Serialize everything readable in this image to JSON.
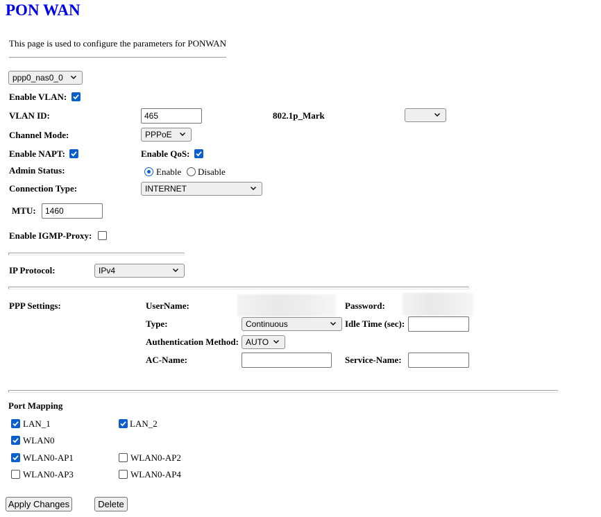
{
  "title": "PON WAN",
  "description": "This page is used to configure the parameters for PONWAN",
  "wan_select": {
    "value": "ppp0_nas0_0"
  },
  "enable_vlan": {
    "label": "Enable VLAN:",
    "checked": true
  },
  "vlan_id": {
    "label": "VLAN ID:",
    "value": "465"
  },
  "mark_8021p": {
    "label": "802.1p_Mark",
    "value": ""
  },
  "channel_mode": {
    "label": "Channel Mode:",
    "value": "PPPoE"
  },
  "enable_napt": {
    "label": "Enable NAPT:",
    "checked": true
  },
  "enable_qos": {
    "label": "Enable QoS:",
    "checked": true
  },
  "admin_status": {
    "label": "Admin Status:",
    "options": [
      "Enable",
      "Disable"
    ],
    "selected": "Enable"
  },
  "connection_type": {
    "label": "Connection Type:",
    "value": "INTERNET"
  },
  "mtu": {
    "label": "MTU:",
    "value": "1460"
  },
  "igmp_proxy": {
    "label": "Enable IGMP-Proxy:",
    "checked": false
  },
  "ip_protocol": {
    "label": "IP Protocol:",
    "value": "IPv4"
  },
  "ppp": {
    "section_label": "PPP Settings:",
    "username_label": "UserName:",
    "password_label": "Password:",
    "type_label": "Type:",
    "type_value": "Continuous",
    "idle_label": "Idle Time (sec):",
    "idle_value": "",
    "auth_label": "Authentication Method:",
    "auth_value": "AUTO",
    "ac_name_label": "AC-Name:",
    "ac_name_value": "",
    "service_name_label": "Service-Name:",
    "service_name_value": ""
  },
  "port_mapping": {
    "label": "Port Mapping",
    "ports": [
      {
        "name": "LAN_1",
        "checked": true
      },
      {
        "name": "LAN_2",
        "checked": true
      },
      {
        "name": "WLAN0",
        "checked": true
      },
      {
        "name": "WLAN0-AP1",
        "checked": true
      },
      {
        "name": "WLAN0-AP2",
        "checked": false
      },
      {
        "name": "WLAN0-AP3",
        "checked": false
      },
      {
        "name": "WLAN0-AP4",
        "checked": false
      }
    ]
  },
  "buttons": {
    "apply": "Apply Changes",
    "delete": "Delete"
  },
  "colors": {
    "title": "#0000ee",
    "checkbox_accent": "#0b5fcc"
  }
}
